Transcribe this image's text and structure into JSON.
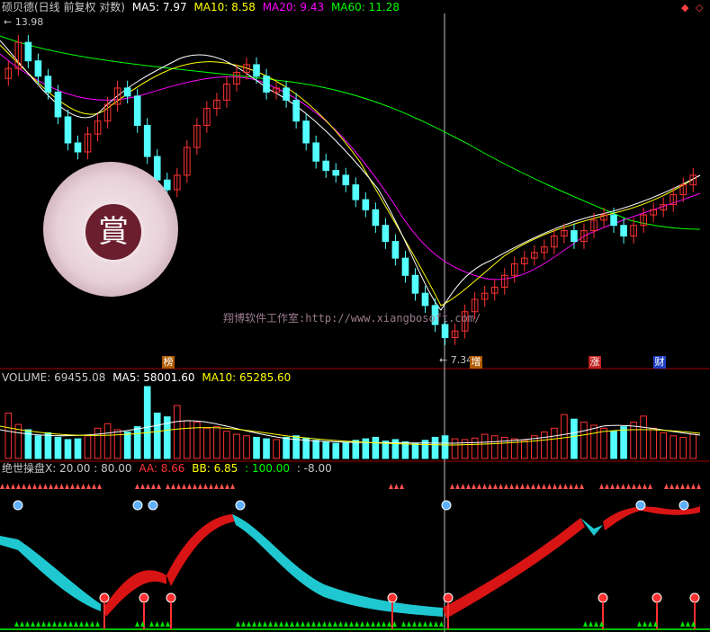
{
  "header": {
    "stock": "硕贝德(日线 前复权 对数)",
    "ma5": "MA5: 7.97",
    "ma10": "MA10: 8.58",
    "ma20": "MA20: 9.43",
    "ma60": "MA60: 11.28"
  },
  "price_labels": {
    "high": "13.98",
    "low": "7.34"
  },
  "event_tags": [
    "榜",
    "增",
    "涨",
    "财"
  ],
  "watermark": "翔博软件工作室:http://www.xiangbosoft.com/",
  "volume_header": {
    "volume": "VOLUME: 69455.08",
    "ma5": "MA5: 58001.60",
    "ma10": "MA10: 65285.60"
  },
  "indicator_header": {
    "name": "绝世操盘X",
    "range": ": 20.00 : 80.00",
    "aa": "AA: 8.66",
    "bb": "BB: 6.85",
    "v1": ": 100.00",
    "v2": ": -8.00"
  },
  "corner_icons": [
    "diamond-up-icon",
    "diamond-icon"
  ],
  "colors": {
    "up": "#ff3232",
    "down": "#54ffff",
    "ma5": "#ffffff",
    "ma10": "#ffff00",
    "ma20": "#ff00ff",
    "ma60": "#00ff00",
    "border": "#a00000"
  },
  "chart_data": {
    "type": "candlestick",
    "price_axis": "log",
    "price_range": [
      7.34,
      13.98
    ],
    "close_trend": [
      12.8,
      13.5,
      13.0,
      12.6,
      12.2,
      11.6,
      11.0,
      10.8,
      11.2,
      11.5,
      11.9,
      12.3,
      12.1,
      11.4,
      10.7,
      10.2,
      10.0,
      10.3,
      10.9,
      11.4,
      11.8,
      12.0,
      12.4,
      12.7,
      12.9,
      12.6,
      12.2,
      12.3,
      12.0,
      11.5,
      11.0,
      10.6,
      10.4,
      10.3,
      10.1,
      9.8,
      9.6,
      9.3,
      9.0,
      8.7,
      8.4,
      8.1,
      7.9,
      7.6,
      7.4,
      7.5,
      7.8,
      8.0,
      8.1,
      8.2,
      8.4,
      8.6,
      8.7,
      8.8,
      8.9,
      9.1,
      9.2,
      9.0,
      9.2,
      9.4,
      9.5,
      9.3,
      9.1,
      9.3,
      9.5,
      9.6,
      9.7,
      9.9,
      10.1,
      10.3
    ],
    "volume_trend": [
      60,
      45,
      38,
      30,
      34,
      28,
      25,
      26,
      30,
      40,
      46,
      38,
      35,
      42,
      95,
      60,
      55,
      70,
      50,
      48,
      40,
      42,
      36,
      32,
      30,
      28,
      26,
      25,
      28,
      30,
      27,
      24,
      22,
      20,
      21,
      24,
      26,
      28,
      23,
      25,
      22,
      20,
      24,
      28,
      30,
      26,
      25,
      27,
      32,
      30,
      28,
      26,
      24,
      30,
      35,
      40,
      58,
      52,
      48,
      44,
      40,
      36,
      42,
      48,
      56,
      40,
      34,
      30,
      28,
      32
    ]
  }
}
